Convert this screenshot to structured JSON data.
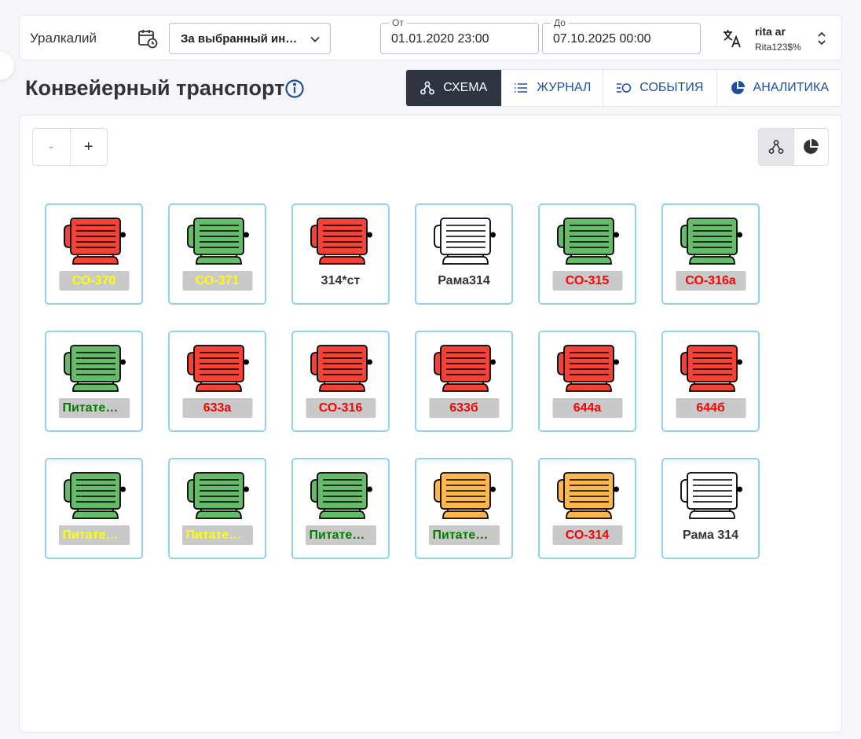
{
  "header": {
    "company": "Уралкалий",
    "range_select": "За выбранный ин…",
    "from": {
      "label": "От",
      "value": "01.01.2020 23:00"
    },
    "to": {
      "label": "До",
      "value": "07.10.2025 00:00"
    },
    "user": {
      "name": "rita ar",
      "login": "Rita123$%"
    }
  },
  "page": {
    "title": "Конвейерный транспорт"
  },
  "tabs": [
    {
      "label": "СХЕМА",
      "icon": "schema-icon",
      "active": true
    },
    {
      "label": "ЖУРНАЛ",
      "icon": "list-icon",
      "active": false
    },
    {
      "label": "СОБЫТИЯ",
      "icon": "events-icon",
      "active": false
    },
    {
      "label": "АНАЛИТИКА",
      "icon": "pie-chart-icon",
      "active": false
    }
  ],
  "zoom": {
    "minus": "-",
    "plus": "+"
  },
  "colors": {
    "red": "#f44336",
    "green": "#66bb6a",
    "orange": "#ffb74d",
    "white": "#ffffff",
    "label_yellow": "#ffff00",
    "label_red": "#ff0000",
    "label_green": "#008000",
    "label_dark": "#333333",
    "card_border": "#8fd3ec",
    "active_tab": "#2f3441"
  },
  "equipment": [
    {
      "label": "СО-370",
      "motor": "red",
      "label_color": "yellow",
      "label_bg": true
    },
    {
      "label": "СО-371",
      "motor": "green",
      "label_color": "yellow",
      "label_bg": true
    },
    {
      "label": "314*ст",
      "motor": "red",
      "label_color": "dark",
      "label_bg": false
    },
    {
      "label": "Рама314",
      "motor": "white",
      "label_color": "dark",
      "label_bg": false
    },
    {
      "label": "СО-315",
      "motor": "green",
      "label_color": "red",
      "label_bg": true
    },
    {
      "label": "СО-316а",
      "motor": "green",
      "label_color": "red",
      "label_bg": true
    },
    {
      "label": "Питател…",
      "motor": "green",
      "label_color": "green",
      "label_bg": true
    },
    {
      "label": "633а",
      "motor": "red",
      "label_color": "red",
      "label_bg": true
    },
    {
      "label": "СО-316",
      "motor": "red",
      "label_color": "red",
      "label_bg": true
    },
    {
      "label": "633б",
      "motor": "red",
      "label_color": "red",
      "label_bg": true
    },
    {
      "label": "644а",
      "motor": "red",
      "label_color": "red",
      "label_bg": true
    },
    {
      "label": "644б",
      "motor": "red",
      "label_color": "red",
      "label_bg": true
    },
    {
      "label": "Питател…",
      "motor": "green",
      "label_color": "yellow",
      "label_bg": true
    },
    {
      "label": "Питател…",
      "motor": "green",
      "label_color": "yellow",
      "label_bg": true
    },
    {
      "label": "Питател…",
      "motor": "green",
      "label_color": "green",
      "label_bg": true
    },
    {
      "label": "Питател…",
      "motor": "orange",
      "label_color": "green",
      "label_bg": true
    },
    {
      "label": "СО-314",
      "motor": "orange",
      "label_color": "red",
      "label_bg": true
    },
    {
      "label": "Рама 314",
      "motor": "white",
      "label_color": "dark",
      "label_bg": false
    }
  ]
}
